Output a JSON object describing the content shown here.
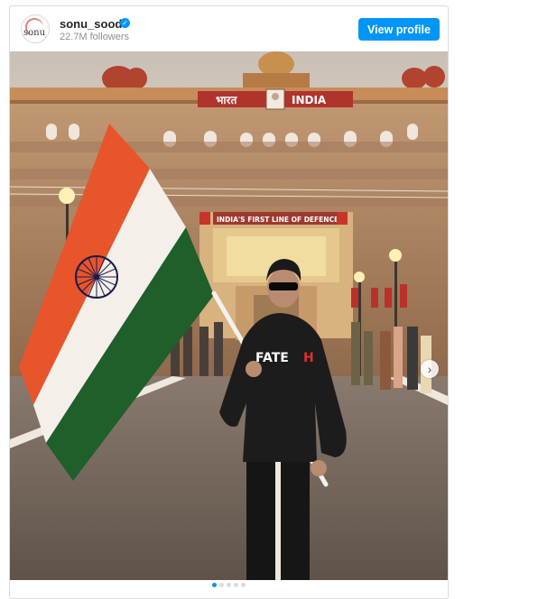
{
  "post": {
    "username": "sonu_sood",
    "avatar_text": "sonu_sood",
    "followers": "22.7M followers",
    "view_profile_label": "View profile",
    "verified_icon": "verified-badge-icon",
    "next_icon": "chevron-right-icon",
    "carousel": {
      "total": 5,
      "current": 1
    }
  },
  "photo": {
    "top_sign_left": "भारत",
    "top_sign_right": "INDIA",
    "gate_sign": "INDIA'S FIRST LINE OF DEFENCE",
    "hoodie_text_main": "FATE",
    "hoodie_text_accent": "H"
  },
  "colors": {
    "accent": "#0095f6",
    "saffron": "#ff7722",
    "green": "#138808",
    "chakra": "#000080"
  }
}
